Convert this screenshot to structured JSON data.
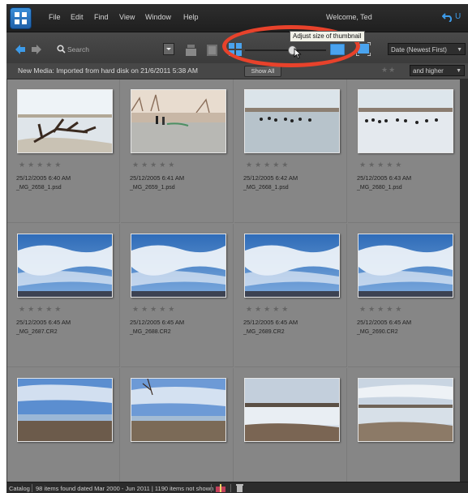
{
  "menu": {
    "items": [
      "File",
      "Edit",
      "Find",
      "View",
      "Window",
      "Help"
    ],
    "welcome": "Welcome, Ted",
    "undo_label": "U"
  },
  "toolbar": {
    "search_placeholder": "Search",
    "tooltip": "Adjust size of thumbnail",
    "sort_label": "Date (Newest First)"
  },
  "infobar": {
    "text": "New Media: Imported from hard disk on 21/6/2011 5:38 AM",
    "show_label": "Show All",
    "rating_label": "and higher"
  },
  "thumbnails": [
    {
      "date": "25/12/2005 6:40 AM",
      "file": "_MG_2658_1.psd",
      "scene": "driftwood"
    },
    {
      "date": "25/12/2005 6:41 AM",
      "file": "_MG_2659_1.psd",
      "scene": "people"
    },
    {
      "date": "25/12/2005 6:42 AM",
      "file": "_MG_2668_1.psd",
      "scene": "geese"
    },
    {
      "date": "25/12/2005 6:43 AM",
      "file": "_MG_2680_1.psd",
      "scene": "geese2"
    },
    {
      "date": "25/12/2005 6:45 AM",
      "file": "_MG_2687.CR2",
      "scene": "sky"
    },
    {
      "date": "25/12/2005 6:45 AM",
      "file": "_MG_2688.CR2",
      "scene": "sky"
    },
    {
      "date": "25/12/2005 6:45 AM",
      "file": "_MG_2689.CR2",
      "scene": "sky"
    },
    {
      "date": "25/12/2005 6:45 AM",
      "file": "_MG_2690.CR2",
      "scene": "sky"
    },
    {
      "date": "",
      "file": "",
      "scene": "shore"
    },
    {
      "date": "",
      "file": "",
      "scene": "shore2"
    },
    {
      "date": "",
      "file": "",
      "scene": "bank"
    },
    {
      "date": "",
      "file": "",
      "scene": "bank2"
    }
  ],
  "status": {
    "catalog": "Catalog",
    "text": "98 items found dated Mar 2000 - Jun 2011  |  1190 items not shown"
  },
  "colors": {
    "annotation": "#e8422b",
    "accent": "#3d9be9"
  }
}
